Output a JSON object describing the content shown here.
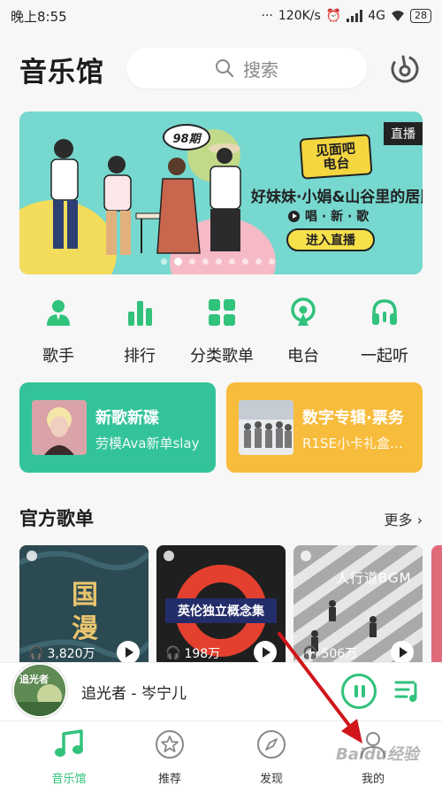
{
  "status_bar": {
    "time": "晚上8:55",
    "network_speed": "120K/s",
    "network": "4G",
    "battery": "28"
  },
  "header": {
    "title": "音乐馆",
    "search_placeholder": "搜索",
    "radar_icon": "radar-icon"
  },
  "banner": {
    "episode": "98期",
    "show_name_top": "见面吧",
    "show_name_bottom": "电台",
    "guests": "好妹妹·小娟&山谷里的居民",
    "sub": "唱 · 新 · 歌",
    "cta": "进入直播",
    "badge": "直播",
    "dot_count": 9,
    "active_dot": 1
  },
  "nav": [
    {
      "label": "歌手",
      "icon": "singer-icon"
    },
    {
      "label": "排行",
      "icon": "chart-icon"
    },
    {
      "label": "分类歌单",
      "icon": "category-icon"
    },
    {
      "label": "电台",
      "icon": "radio-icon"
    },
    {
      "label": "一起听",
      "icon": "headphones-icon"
    }
  ],
  "promos": [
    {
      "title": "新歌新碟",
      "sub": "劳模Ava新单slay",
      "color": "#33c39a"
    },
    {
      "title": "数字专辑·票务",
      "sub": "R1SE小卡礼盒…",
      "color": "#f8bc3c"
    }
  ],
  "section": {
    "title": "官方歌单",
    "more": "更多"
  },
  "playlists": [
    {
      "name": "国漫",
      "plays": "3,820万"
    },
    {
      "name": "英伦独立概念集",
      "plays": "198万"
    },
    {
      "name": "人行道BGM",
      "plays": "506万"
    }
  ],
  "mini_player": {
    "cover_text": "追光者",
    "track": "追光者 - 岑宁儿"
  },
  "tabs": [
    {
      "label": "音乐馆",
      "icon": "music-note-icon",
      "active": true
    },
    {
      "label": "推荐",
      "icon": "star-icon",
      "active": false
    },
    {
      "label": "发现",
      "icon": "compass-icon",
      "active": false
    },
    {
      "label": "我的",
      "icon": "user-icon",
      "active": false
    }
  ],
  "watermark": "Baidu经验",
  "colors": {
    "accent": "#31c27c",
    "annotation_arrow": "#d0161b"
  }
}
